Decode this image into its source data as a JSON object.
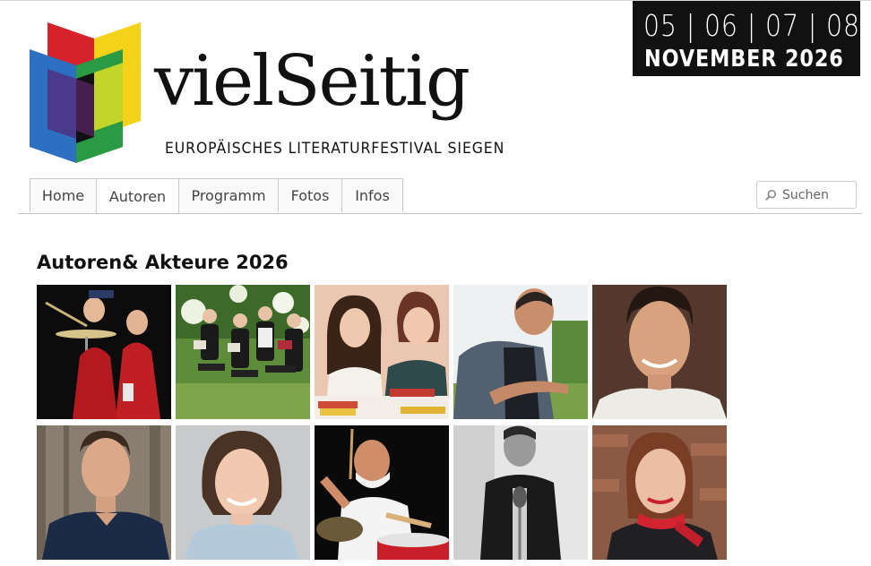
{
  "header": {
    "logo": {
      "wordmark": "vielSeitig",
      "subtitle": "EUROPÄISCHES LITERATURFESTIVAL SIEGEN"
    },
    "dates": {
      "days": "05 | 06 | 07 | 08",
      "month_year": "NOVEMBER 2026"
    }
  },
  "nav": {
    "tabs": [
      {
        "label": "Home",
        "active": false
      },
      {
        "label": "Autoren",
        "active": true
      },
      {
        "label": "Programm",
        "active": false
      },
      {
        "label": "Fotos",
        "active": false
      },
      {
        "label": "Infos",
        "active": false
      }
    ]
  },
  "search": {
    "placeholder": "Suchen",
    "icon": "search-icon"
  },
  "main": {
    "title": "Autoren& Akteure 2026",
    "photos": [
      {
        "icon": "photo-performers-cymbal"
      },
      {
        "icon": "photo-group-reading-garden"
      },
      {
        "icon": "photo-two-women-books"
      },
      {
        "icon": "photo-man-pointing-outdoors"
      },
      {
        "icon": "photo-man-smiling-portrait"
      },
      {
        "icon": "photo-man-wood-background"
      },
      {
        "icon": "photo-woman-smiling-portrait"
      },
      {
        "icon": "photo-drummer-performing"
      },
      {
        "icon": "photo-singer-microphone-bw"
      },
      {
        "icon": "photo-woman-red-scarf"
      }
    ]
  },
  "colors": {
    "logo_red": "#d6232b",
    "logo_yellow": "#f5d21a",
    "logo_blue": "#2d6fc0",
    "logo_green": "#2a9a45",
    "logo_lime": "#c3d42a",
    "logo_purple": "#4a3a8c",
    "date_bg": "#111111"
  }
}
